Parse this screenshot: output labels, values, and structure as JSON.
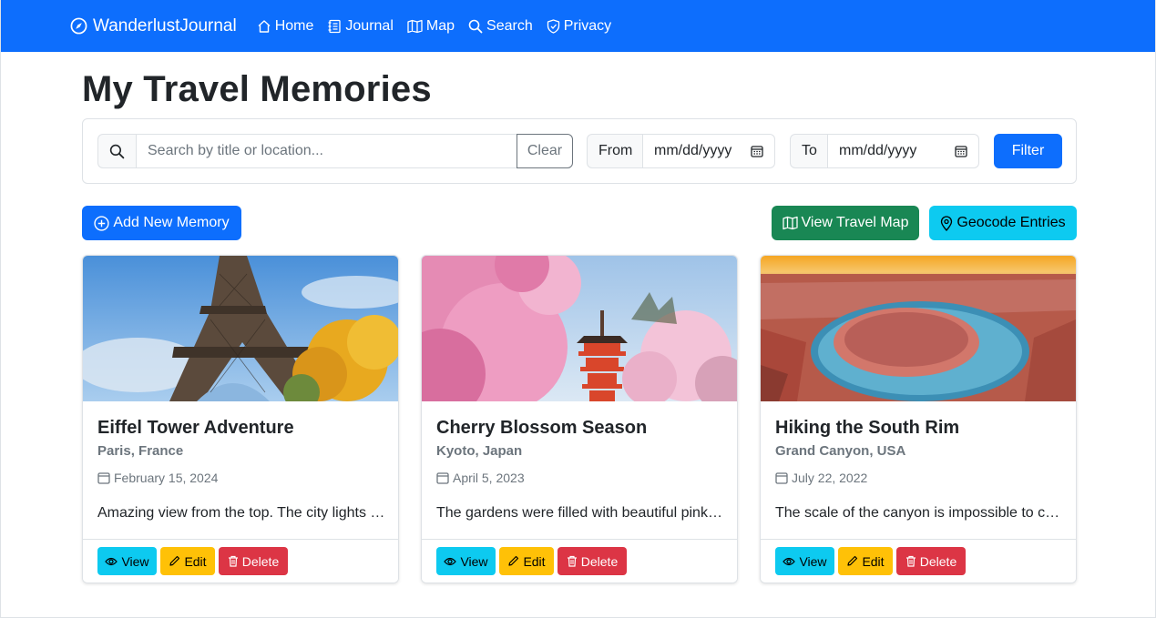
{
  "navbar": {
    "brand": "WanderlustJournal",
    "items": [
      {
        "label": "Home",
        "icon": "house-icon"
      },
      {
        "label": "Journal",
        "icon": "journal-icon"
      },
      {
        "label": "Map",
        "icon": "map-icon"
      },
      {
        "label": "Search",
        "icon": "search-icon"
      },
      {
        "label": "Privacy",
        "icon": "shield-icon"
      }
    ]
  },
  "page_title": "My Travel Memories",
  "filter": {
    "search_placeholder": "Search by title or location...",
    "clear_label": "Clear",
    "from_label": "From",
    "from_placeholder": "mm/dd/yyyy",
    "to_label": "To",
    "to_placeholder": "mm/dd/yyyy",
    "filter_label": "Filter"
  },
  "actions": {
    "add_label": "Add New Memory",
    "map_label": "View Travel Map",
    "geocode_label": "Geocode Entries"
  },
  "cards": [
    {
      "title": "Eiffel Tower Adventure",
      "location": "Paris, France",
      "date": "February 15, 2024",
      "description": "Amazing view from the top. The city lights at night were unforgettable.",
      "image": "eiffel-tower-photo"
    },
    {
      "title": "Cherry Blossom Season",
      "location": "Kyoto, Japan",
      "date": "April 5, 2023",
      "description": "The gardens were filled with beautiful pink blossoms everywhere.",
      "image": "cherry-blossom-pagoda-photo"
    },
    {
      "title": "Hiking the South Rim",
      "location": "Grand Canyon, USA",
      "date": "July 22, 2022",
      "description": "The scale of the canyon is impossible to capture in photos.",
      "image": "horseshoe-bend-canyon-photo"
    }
  ],
  "card_buttons": {
    "view": "View",
    "edit": "Edit",
    "delete": "Delete"
  },
  "colors": {
    "primary": "#0d6efd",
    "success": "#198754",
    "info": "#0dcaf0",
    "warning": "#ffc107",
    "danger": "#dc3545"
  }
}
